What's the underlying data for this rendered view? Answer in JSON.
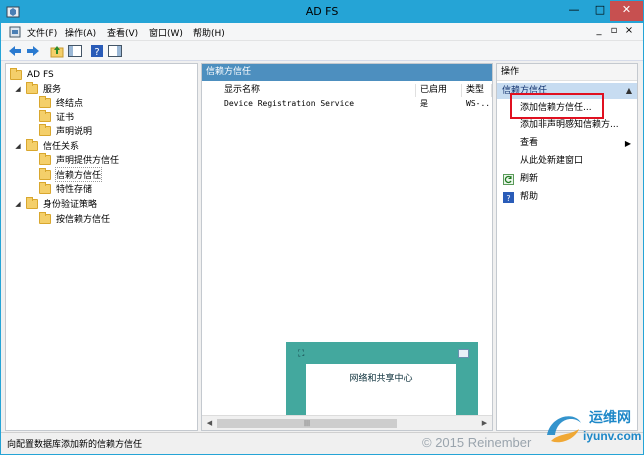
{
  "window": {
    "title": "AD FS"
  },
  "menu": [
    "文件(F)",
    "操作(A)",
    "查看(V)",
    "窗口(W)",
    "帮助(H)"
  ],
  "tree": {
    "root": "AD FS",
    "items": [
      {
        "label": "服务",
        "level": 1,
        "expanded": true
      },
      {
        "label": "终结点",
        "level": 2
      },
      {
        "label": "证书",
        "level": 2
      },
      {
        "label": "声明说明",
        "level": 2
      },
      {
        "label": "信任关系",
        "level": 1,
        "expanded": true
      },
      {
        "label": "声明提供方信任",
        "level": 2
      },
      {
        "label": "信赖方信任",
        "level": 2,
        "selected": true
      },
      {
        "label": "特性存储",
        "level": 2
      },
      {
        "label": "身份验证策略",
        "level": 1,
        "expanded": true
      },
      {
        "label": "按信赖方信任",
        "level": 2
      }
    ]
  },
  "center": {
    "header": "信赖方信任",
    "columns": [
      "显示名称",
      "已启用",
      "类型"
    ],
    "rows": [
      {
        "name": "Device Registration Service",
        "enabled": "是",
        "type": "WS-..."
      }
    ],
    "scroll_thumb": "|||"
  },
  "overlay": {
    "title": "网络和共享中心"
  },
  "actions": {
    "header": "操作",
    "subheader": "信赖方信任",
    "items": [
      {
        "label": "添加信赖方信任...",
        "highlighted": true
      },
      {
        "label": "添加非声明感知信赖方..."
      },
      {
        "label": "查看",
        "submenu": true
      },
      {
        "label": "从此处新建窗口"
      },
      {
        "label": "刷新",
        "icon": "refresh-icon"
      },
      {
        "label": "帮助",
        "icon": "help-icon"
      }
    ]
  },
  "status": {
    "text": "向配置数据库添加新的信赖方信任"
  },
  "watermark": {
    "copyright": "© 2015 Reinember",
    "brand": "运维网",
    "url": "iyunv.com"
  },
  "colors": {
    "titlebar": "#25a4d6",
    "center_header": "#4d8fbf",
    "highlight_box": "#e01020",
    "overlay": "#43a89e"
  }
}
